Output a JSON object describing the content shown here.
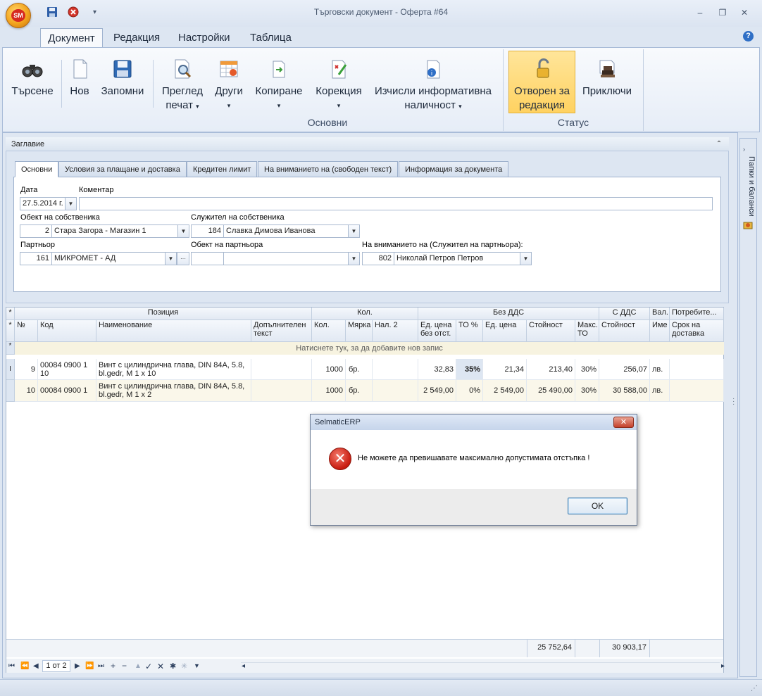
{
  "window": {
    "title": "Търговски документ - Оферта #64",
    "app_logo": "SM",
    "controls": [
      "–",
      "❐",
      "✕"
    ]
  },
  "qat": {
    "save_icon": "save-icon",
    "close_icon": "close-doc-icon",
    "more": "▾"
  },
  "ribbon": {
    "tabs": [
      "Документ",
      "Редакция",
      "Настройки",
      "Таблица"
    ],
    "buttons": {
      "search": "Търсене",
      "new": "Нов",
      "save": "Запомни",
      "preview_1": "Преглед",
      "preview_2": "печат",
      "other": "Други",
      "copy": "Копиране",
      "correction": "Корекция",
      "calc_1": "Изчисли информативна",
      "calc_2": "наличност",
      "open_1": "Отворен за",
      "open_2": "редакция",
      "finish": "Приключи",
      "arrow": "▾"
    },
    "groups": {
      "main": "Основни",
      "status": "Статус"
    }
  },
  "header": {
    "caption": "Заглавие",
    "collapse": "⌃",
    "tabs": [
      "Основни",
      "Условия за плащане и доставка",
      "Кредитен лимит",
      "На вниманието на (свободен текст)",
      "Информация за документа"
    ],
    "fields": {
      "date_label": "Дата",
      "date_value": "27.5.2014 г.",
      "comment_label": "Коментар",
      "comment_value": "",
      "owner_obj_label": "Обект на собственика",
      "owner_obj_code": "2",
      "owner_obj_name": "Стара Загора - Магазин 1",
      "owner_emp_label": "Служител на собственика",
      "owner_emp_code": "184",
      "owner_emp_name": "Славка Димова Иванова",
      "partner_label": "Партньор",
      "partner_code": "161",
      "partner_name": "МИКРОМЕТ - АД",
      "partner_more": "···",
      "partner_obj_label": "Обект на партньора",
      "partner_obj_code": "",
      "partner_obj_name": "",
      "attention_label": "На вниманието на (Служител на партньора):",
      "attention_code": "802",
      "attention_name": "Николай Петров Петров"
    }
  },
  "grid": {
    "band_headers": {
      "position": "Позиция",
      "qty": "Кол.",
      "no_vat": "Без ДДС",
      "with_vat": "С ДДС",
      "cur": "Вал.",
      "consumer": "Потребите..."
    },
    "columns": {
      "no": "№",
      "code": "Код",
      "name": "Наименование",
      "extra": "Допълнителен текст",
      "qty": "Кол.",
      "unit": "Мярка",
      "avail2": "Нал. 2",
      "unit_price_no_disc": "Ед. цена без отст.",
      "to_pct": "ТО %",
      "unit_price": "Ед. цена",
      "value": "Стойност",
      "max_to": "Макс. ТО",
      "value_vat": "Стойност",
      "cur_name": "Име",
      "delivery": "Срок на доставка"
    },
    "new_row_hint": "Натиснете тук, за да добавите нов запис",
    "marker_star": "*",
    "rows": [
      {
        "marker": "I",
        "no": "9",
        "code": "00084 0900 1 10",
        "name": "Винт с цилиндрична глава, DIN 84A, 5.8, bl.gedr, M 1 x 10",
        "extra": "",
        "qty": "1000",
        "unit": "бр.",
        "avail2": "",
        "price_no_disc": "32,83",
        "to_pct": "35%",
        "price": "21,34",
        "value": "213,40",
        "max_to": "30%",
        "value_vat": "256,07",
        "cur": "лв.",
        "delivery": ""
      },
      {
        "marker": "",
        "no": "10",
        "code": "00084 0900 1 2",
        "name": "Винт с цилиндрична глава, DIN 84A, 5.8, bl.gedr, M 1 x 2",
        "extra": "",
        "qty": "1000",
        "unit": "бр.",
        "avail2": "",
        "price_no_disc": "2 549,00",
        "to_pct": "0%",
        "price": "2 549,00",
        "value": "25 490,00",
        "max_to": "30%",
        "value_vat": "30 588,00",
        "cur": "лв.",
        "delivery": ""
      }
    ],
    "totals": {
      "value": "25 752,64",
      "value_vat": "30 903,17"
    },
    "nav": {
      "first": "⏮",
      "prev_page": "⏪",
      "prev": "◀",
      "page": "1 от 2",
      "next": "▶",
      "next_page": "⏩",
      "last": "⏭",
      "add": "+",
      "remove": "−",
      "up": "▲",
      "check": "✓",
      "cancel": "✕",
      "star": "✱",
      "star2": "✳",
      "filter": "▼",
      "left": "◂",
      "right": "▸"
    }
  },
  "sidebar": {
    "label": "Папки и баланси"
  },
  "dialog": {
    "title": "SelmaticERP",
    "close": "✕",
    "icon": "✕",
    "message": "Не можете да превишавате максимално допустимата отстъпка !",
    "ok": "OK"
  }
}
